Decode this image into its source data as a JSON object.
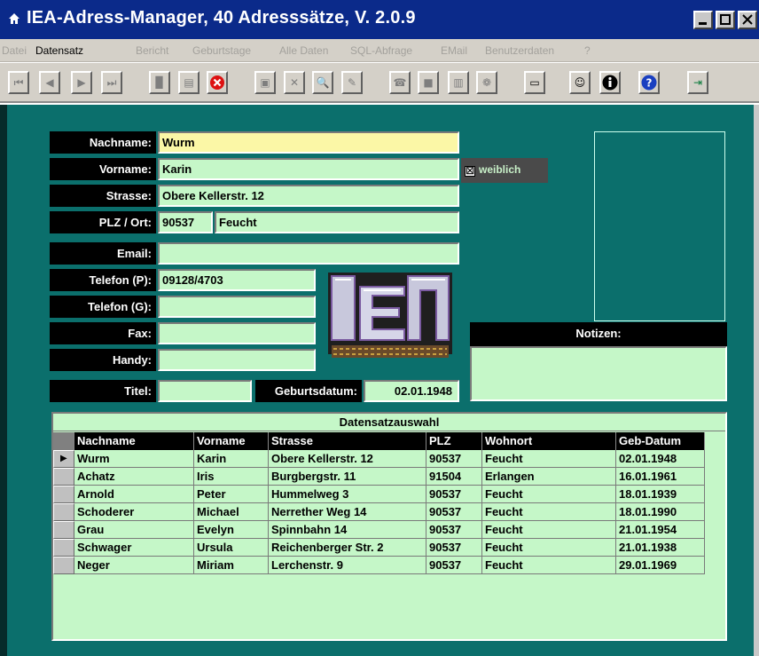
{
  "window": {
    "title": "IEA-Adress-Manager, 40 Adresssätze, V. 2.0.9",
    "title_bg": "#0b2a8a"
  },
  "menu": {
    "items": [
      "Datei",
      "Datensatz",
      "Bericht",
      "Geburtstage",
      "Alle Daten",
      "SQL-Abfrage",
      "EMail",
      "Benutzerdaten",
      "?"
    ],
    "active_index": 1
  },
  "toolbar": {
    "icons": [
      "first-record-icon",
      "previous-record-icon",
      "next-record-icon",
      "last-record-icon",
      "new-record-icon",
      "copy-record-icon",
      "delete-record-icon",
      "save-icon",
      "cancel-icon",
      "find-icon",
      "edit-icon",
      "phone-icon",
      "stop-icon",
      "book-icon",
      "globe-icon",
      "card-icon",
      "person-card-icon",
      "info-icon",
      "help-icon",
      "exit-icon"
    ]
  },
  "form": {
    "labels": {
      "nachname": "Nachname:",
      "vorname": "Vorname:",
      "strasse": "Strasse:",
      "plz_ort": "PLZ / Ort:",
      "email": "Email:",
      "telefon_p": "Telefon (P):",
      "telefon_g": "Telefon (G):",
      "fax": "Fax:",
      "handy": "Handy:",
      "titel": "Titel:",
      "geburtsdatum": "Geburtsdatum:",
      "notizen": "Notizen:"
    },
    "values": {
      "nachname": "Wurm",
      "vorname": "Karin",
      "strasse": "Obere Kellerstr. 12",
      "plz": "90537",
      "ort": "Feucht",
      "email": "",
      "telefon_p": "09128/4703",
      "telefon_g": "",
      "fax": "",
      "handy": "",
      "titel": "",
      "geburtsdatum": "02.01.1948",
      "notizen": ""
    },
    "weiblich": {
      "label": "weiblich",
      "checked": true,
      "mark": "☒"
    }
  },
  "grid": {
    "title": "Datensatzauswahl",
    "columns": [
      "Nachname",
      "Vorname",
      "Strasse",
      "PLZ",
      "Wohnort",
      "Geb-Datum"
    ],
    "rows": [
      [
        "Wurm",
        "Karin",
        "Obere Kellerstr. 12",
        "90537",
        "Feucht",
        "02.01.1948"
      ],
      [
        "Achatz",
        "Iris",
        "Burgbergstr. 11",
        "91504",
        "Erlangen",
        "16.01.1961"
      ],
      [
        "Arnold",
        "Peter",
        "Hummelweg 3",
        "90537",
        "Feucht",
        "18.01.1939"
      ],
      [
        "Schoderer",
        "Michael",
        "Nerrether Weg 14",
        "90537",
        "Feucht",
        "18.01.1990"
      ],
      [
        "Grau",
        "Evelyn",
        "Spinnbahn 14",
        "90537",
        "Feucht",
        "21.01.1954"
      ],
      [
        "Schwager",
        "Ursula",
        "Reichenberger Str. 2",
        "90537",
        "Feucht",
        "21.01.1938"
      ],
      [
        "Neger",
        "Miriam",
        "Lerchenstr. 9",
        "90537",
        "Feucht",
        "29.01.1969"
      ]
    ],
    "current_row": 0,
    "current_marker": "▶"
  },
  "colors": {
    "background": "#0b6f6c",
    "field": "#c5f7c8",
    "field_active": "#fbf7a6",
    "label_bg": "#000000"
  }
}
